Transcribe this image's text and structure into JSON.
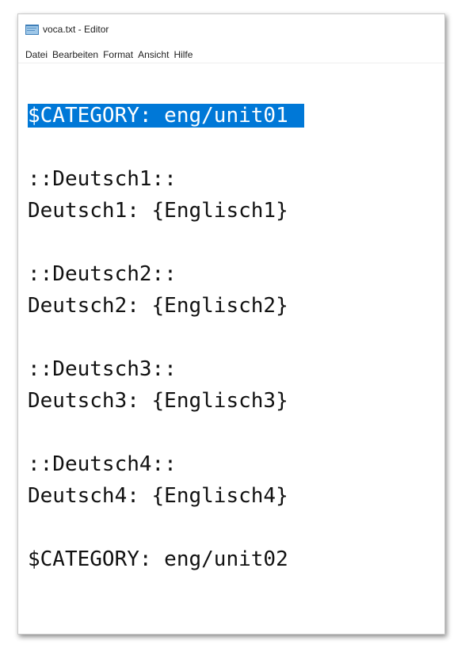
{
  "window": {
    "title": "voca.txt - Editor",
    "icon": "notepad-icon"
  },
  "menu": {
    "items": [
      "Datei",
      "Bearbeiten",
      "Format",
      "Ansicht",
      "Hilfe"
    ]
  },
  "editor": {
    "selection_color": "#0078d7",
    "lines": [
      "$CATEGORY: eng/unit01",
      "",
      "::Deutsch1::",
      "Deutsch1: {Englisch1}",
      "",
      "::Deutsch2::",
      "Deutsch2: {Englisch2}",
      "",
      "::Deutsch3::",
      "Deutsch3: {Englisch3}",
      "",
      "::Deutsch4::",
      "Deutsch4: {Englisch4}",
      "",
      "$CATEGORY: eng/unit02"
    ]
  }
}
